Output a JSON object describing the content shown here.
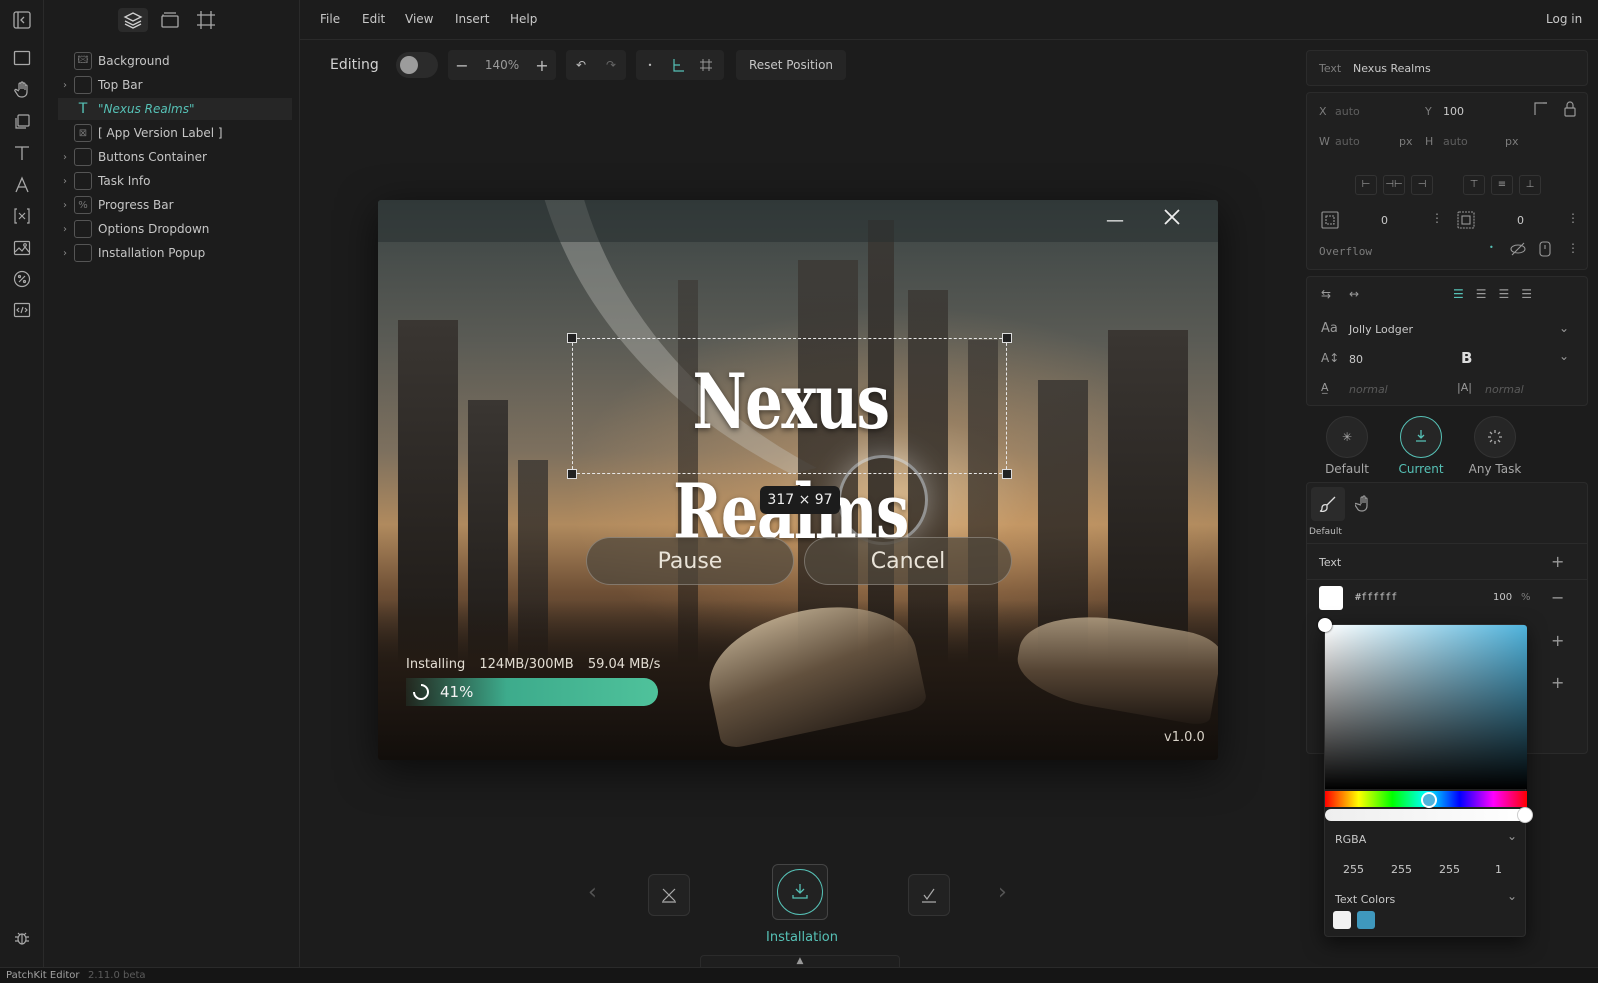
{
  "menu": {
    "items": [
      "File",
      "Edit",
      "View",
      "Insert",
      "Help"
    ],
    "login": "Log in"
  },
  "toolbar": {
    "editing_label": "Editing",
    "zoom": "140%",
    "reset_position": "Reset Position"
  },
  "layers": [
    {
      "name": "Background",
      "expandable": false,
      "selected": false
    },
    {
      "name": "Top Bar",
      "expandable": true,
      "selected": false
    },
    {
      "name": "\"Nexus Realms\"",
      "expandable": false,
      "selected": true
    },
    {
      "name": "[ App Version Label ]",
      "expandable": false,
      "selected": false
    },
    {
      "name": "Buttons Container",
      "expandable": true,
      "selected": false
    },
    {
      "name": "Task Info",
      "expandable": true,
      "selected": false
    },
    {
      "name": "Progress Bar",
      "expandable": true,
      "selected": false
    },
    {
      "name": "Options Dropdown",
      "expandable": true,
      "selected": false
    },
    {
      "name": "Installation Popup",
      "expandable": true,
      "selected": false
    }
  ],
  "canvas": {
    "title": "Nexus Realms",
    "size_badge": "317 × 97",
    "pause": "Pause",
    "cancel": "Cancel",
    "installing": "Installing",
    "downloaded": "124MB/300MB",
    "speed": "59.04 MB/s",
    "progress_label": "41%",
    "progress": 0.41,
    "version": "v1.0.0"
  },
  "steps": {
    "current_label": "Installation"
  },
  "props": {
    "type_label": "Text",
    "name": "Nexus Realms",
    "x_label": "X",
    "x": "auto",
    "y_label": "Y",
    "y": "100",
    "w_label": "W",
    "w": "auto",
    "w_unit": "px",
    "h_label": "H",
    "h": "auto",
    "h_unit": "px",
    "pad1": "0",
    "pad2": "0",
    "overflow": "Overflow",
    "font": "Jolly Lodger",
    "font_size": "80",
    "line_height": "normal",
    "letter_spacing": "normal",
    "states": [
      "Default",
      "Current",
      "Any Task"
    ],
    "style_tab": "Default",
    "fill_section": "Text",
    "fill_hex": "#ffffff",
    "fill_opacity": "100",
    "fill_unit": "%"
  },
  "picker": {
    "mode": "RGBA",
    "r": "255",
    "g": "255",
    "b": "255",
    "a": "1",
    "text_colors": "Text Colors",
    "swatches": [
      "#f2f2f2",
      "#3f98bd"
    ]
  },
  "status": {
    "app": "PatchKit Editor",
    "version": "2.11.0 beta"
  },
  "colors": {
    "accent": "#56c1b6",
    "progress": "#3dab8c"
  }
}
